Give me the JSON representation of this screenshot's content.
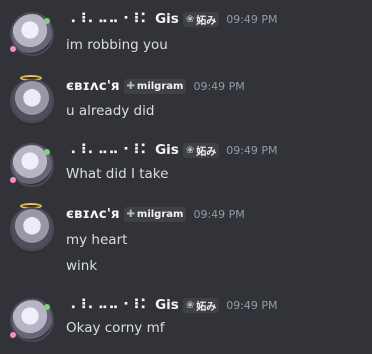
{
  "messages": [
    {
      "author": "⠠⠸⠄⠤⠤⠐⠸⠅ Gis",
      "tag": "妬み",
      "tag_icon": "❀",
      "time": "09:49 PM",
      "lines": [
        "im robbing you"
      ]
    },
    {
      "author": "євɪʌc'я",
      "tag": "milgram",
      "tag_icon": "✚",
      "time": "09:49 PM",
      "lines": [
        "u already did"
      ]
    },
    {
      "author": "⠠⠸⠄⠤⠤⠐⠸⠅ Gis",
      "tag": "妬み",
      "tag_icon": "❀",
      "time": "09:49 PM",
      "lines": [
        "What did I take"
      ]
    },
    {
      "author": "євɪʌc'я",
      "tag": "milgram",
      "tag_icon": "✚",
      "time": "09:49 PM",
      "lines": [
        "my heart",
        "wink"
      ]
    },
    {
      "author": "⠠⠸⠄⠤⠤⠐⠸⠅ Gis",
      "tag": "妬み",
      "tag_icon": "❀",
      "time": "09:49 PM",
      "lines": [
        "Okay corny mf"
      ]
    }
  ]
}
